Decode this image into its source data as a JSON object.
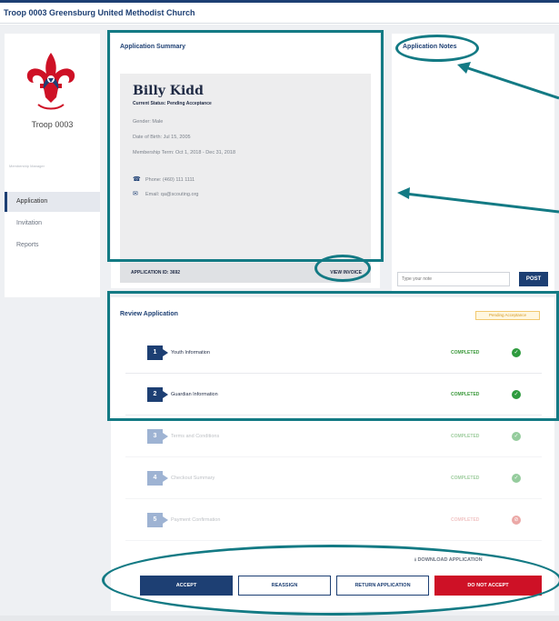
{
  "header": {
    "title": "Troop 0003 Greensburg United Methodist Church"
  },
  "sidebar": {
    "troop_label": "Troop 0003",
    "section_label": "Membership Manager",
    "items": [
      {
        "label": "Application",
        "active": true
      },
      {
        "label": "Invitation",
        "active": false
      },
      {
        "label": "Reports",
        "active": false
      }
    ]
  },
  "summary": {
    "title": "Application Summary",
    "name": "Billy Kidd",
    "status": "Current Status: Pending Acceptance",
    "gender": "Gender: Male",
    "dob": "Date of Birth: Jul 15, 2005",
    "term": "Membership Term: Oct 1, 2018 - Dec 31, 2018",
    "phone": "Phone: (460) 111 1111",
    "email": "Email: qa@scouting.org",
    "app_id": "APPLICATION ID: 3692",
    "view_invoice": "VIEW INVOICE"
  },
  "notes": {
    "title": "Application Notes",
    "placeholder": "Type your note",
    "post_label": "POST"
  },
  "review": {
    "title": "Review Application",
    "badge": "Pending Acceptance",
    "steps": [
      {
        "num": "1",
        "label": "Youth Information",
        "status": "COMPLETED"
      },
      {
        "num": "2",
        "label": "Guardian Information",
        "status": "COMPLETED"
      },
      {
        "num": "3",
        "label": "Terms and Conditions",
        "status": "COMPLETED"
      },
      {
        "num": "4",
        "label": "Checkout Summary",
        "status": "COMPLETED"
      },
      {
        "num": "5",
        "label": "Payment Confirmation",
        "status": "COMPLETED"
      }
    ],
    "download": "DOWNLOAD APPLICATION",
    "actions": {
      "accept": "ACCEPT",
      "reassign": "REASSIGN",
      "return": "RETURN APPLICATION",
      "decline": "DO NOT ACCEPT"
    }
  },
  "colors": {
    "brand_navy": "#1d3f73",
    "annotation_teal": "#137a84",
    "danger_red": "#ce1126",
    "success_green": "#2e9b3e",
    "pending_amber": "#d69a22"
  },
  "icons": [
    "bsa-fleur-de-lis-logo",
    "phone-icon",
    "email-icon",
    "check-icon",
    "error-icon",
    "download-icon"
  ]
}
